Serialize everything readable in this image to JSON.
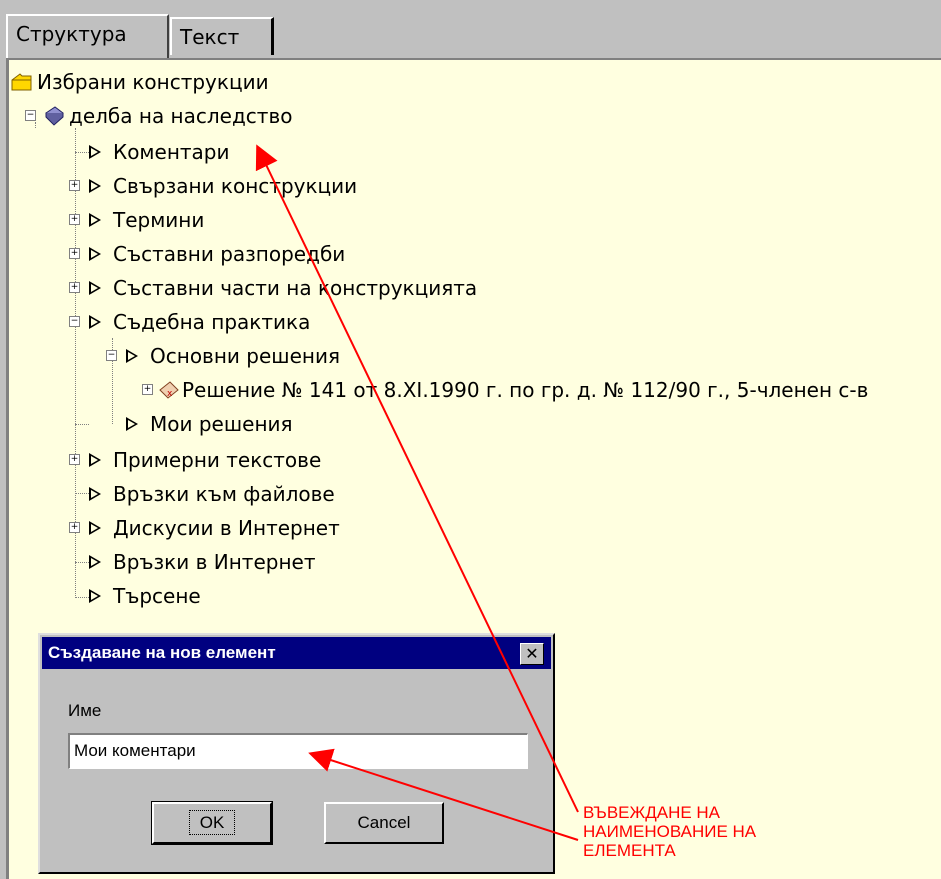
{
  "tabs": [
    {
      "label": "Структура"
    },
    {
      "label": "Текст"
    }
  ],
  "tree": {
    "root_label": "Избрани конструкции",
    "item_label": "делба на наследство",
    "children": [
      {
        "label": "Коментари"
      },
      {
        "label": "Свързани конструкции"
      },
      {
        "label": "Термини"
      },
      {
        "label": "Съставни разпоредби"
      },
      {
        "label": "Съставни части на конструкцията"
      },
      {
        "label": "Съдебна практика"
      },
      {
        "label": "Основни решения"
      },
      {
        "label": "Решение № 141 от 8.XI.1990 г. по гр. д. № 112/90 г., 5-членен с-в"
      },
      {
        "label": "Мои решения"
      },
      {
        "label": "Примерни текстове"
      },
      {
        "label": "Връзки към файлове"
      },
      {
        "label": "Дискусии в Интернет"
      },
      {
        "label": "Връзки в Интернет"
      },
      {
        "label": "Търсене"
      }
    ]
  },
  "dialog": {
    "title": "Създаване на нов елемент",
    "close_label": "✕",
    "name_label": "Име",
    "name_value": "Мои коментари",
    "ok_label": "OK",
    "cancel_label": "Cancel"
  },
  "annotation": {
    "lines": [
      "ВЪВЕЖДАНЕ НА",
      "НАИМЕНОВАНИЕ НА",
      "ЕЛЕМЕНТА"
    ]
  },
  "colors": {
    "panel_bg": "#ffffe0",
    "titlebar": "#000080",
    "annotation": "#ff0000"
  }
}
